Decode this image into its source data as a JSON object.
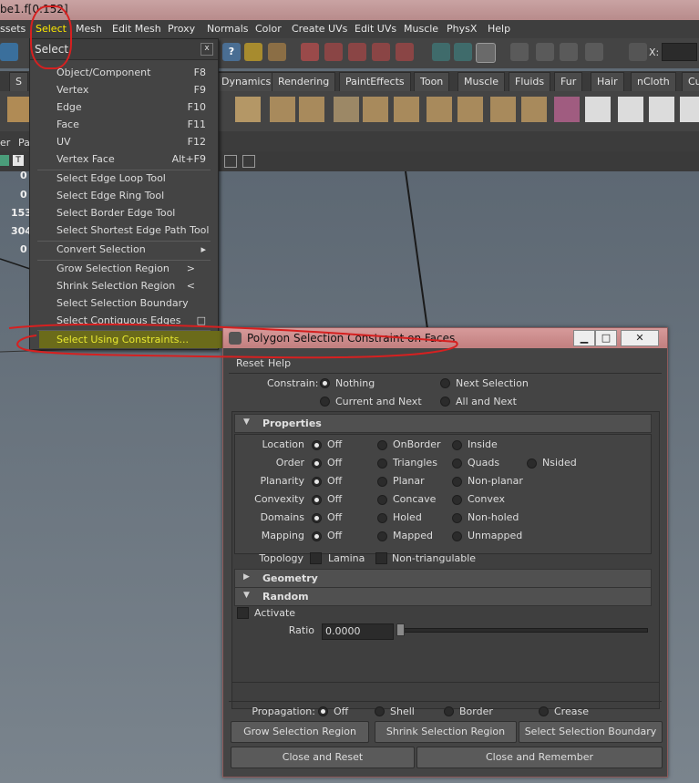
{
  "window": {
    "title": "be1.f[0:152]"
  },
  "menubar": {
    "items": [
      "ssets",
      "Select",
      "Mesh",
      "Edit Mesh",
      "Proxy",
      "Normals",
      "Color",
      "Create UVs",
      "Edit UVs",
      "Muscle",
      "PhysX",
      "Help"
    ]
  },
  "toolbar": {
    "x_label": "X:"
  },
  "shelf": {
    "tabs": [
      "S",
      "Dynamics",
      "Rendering",
      "PaintEffects",
      "Toon",
      "Muscle",
      "Fluids",
      "Fur",
      "Hair",
      "nCloth",
      "Cu"
    ]
  },
  "channel_bar": {
    "label1": "er",
    "label2": "Pa"
  },
  "channel_values": [
    "0",
    "0",
    "153",
    "304",
    "0"
  ],
  "select_menu": {
    "title": "Select",
    "close": "x",
    "groups": [
      [
        {
          "label": "Object/Component",
          "shortcut": "F8"
        },
        {
          "label": "Vertex",
          "shortcut": "F9"
        },
        {
          "label": "Edge",
          "shortcut": "F10"
        },
        {
          "label": "Face",
          "shortcut": "F11"
        },
        {
          "label": "UV",
          "shortcut": "F12"
        },
        {
          "label": "Vertex Face",
          "shortcut": "Alt+F9"
        }
      ],
      [
        {
          "label": "Select Edge Loop Tool"
        },
        {
          "label": "Select Edge Ring Tool"
        },
        {
          "label": "Select Border Edge Tool"
        },
        {
          "label": "Select Shortest Edge Path Tool"
        }
      ],
      [
        {
          "label": "Convert Selection",
          "shortcut": "▸"
        }
      ],
      [
        {
          "label": "Grow Selection Region",
          "shortcut": ">"
        },
        {
          "label": "Shrink Selection Region",
          "shortcut": "<"
        },
        {
          "label": "Select Selection Boundary"
        },
        {
          "label": "Select Contiguous Edges",
          "shortcut": "□"
        }
      ],
      [
        {
          "label": "Select Using Constraints...",
          "highlighted": true
        }
      ]
    ]
  },
  "dialog": {
    "title": "Polygon Selection Constraint on Faces",
    "menu": [
      "Reset",
      "Help"
    ],
    "constrain": {
      "label": "Constrain:",
      "options": [
        "Nothing",
        "Next Selection",
        "Current and Next",
        "All and Next"
      ],
      "selected": "Nothing"
    },
    "properties": {
      "title": "Properties",
      "rows": [
        {
          "label": "Location",
          "options": [
            "Off",
            "OnBorder",
            "Inside"
          ],
          "selected": 0
        },
        {
          "label": "Order",
          "options": [
            "Off",
            "Triangles",
            "Quads",
            "Nsided"
          ],
          "selected": 0
        },
        {
          "label": "Planarity",
          "options": [
            "Off",
            "Planar",
            "Non-planar"
          ],
          "selected": 0
        },
        {
          "label": "Convexity",
          "options": [
            "Off",
            "Concave",
            "Convex"
          ],
          "selected": 0
        },
        {
          "label": "Domains",
          "options": [
            "Off",
            "Holed",
            "Non-holed"
          ],
          "selected": 0
        },
        {
          "label": "Mapping",
          "options": [
            "Off",
            "Mapped",
            "Unmapped"
          ],
          "selected": 0
        }
      ],
      "topology": {
        "label": "Topology",
        "checks": [
          "Lamina",
          "Non-triangulable"
        ]
      }
    },
    "geometry": {
      "title": "Geometry"
    },
    "random": {
      "title": "Random",
      "activate": "Activate",
      "ratio_label": "Ratio",
      "ratio_value": "0.0000",
      "ratio_fraction": 0.0
    },
    "propagation": {
      "label": "Propagation:",
      "options": [
        "Off",
        "Shell",
        "Border",
        "Crease"
      ],
      "selected": "Off"
    },
    "buttons": {
      "grow": "Grow Selection Region",
      "shrink": "Shrink Selection Region",
      "boundary": "Select Selection Boundary",
      "close_reset": "Close and Reset",
      "close_remember": "Close and Remember"
    },
    "win_buttons": {
      "minimize": "▁",
      "maximize": "□",
      "close": "✕"
    }
  }
}
